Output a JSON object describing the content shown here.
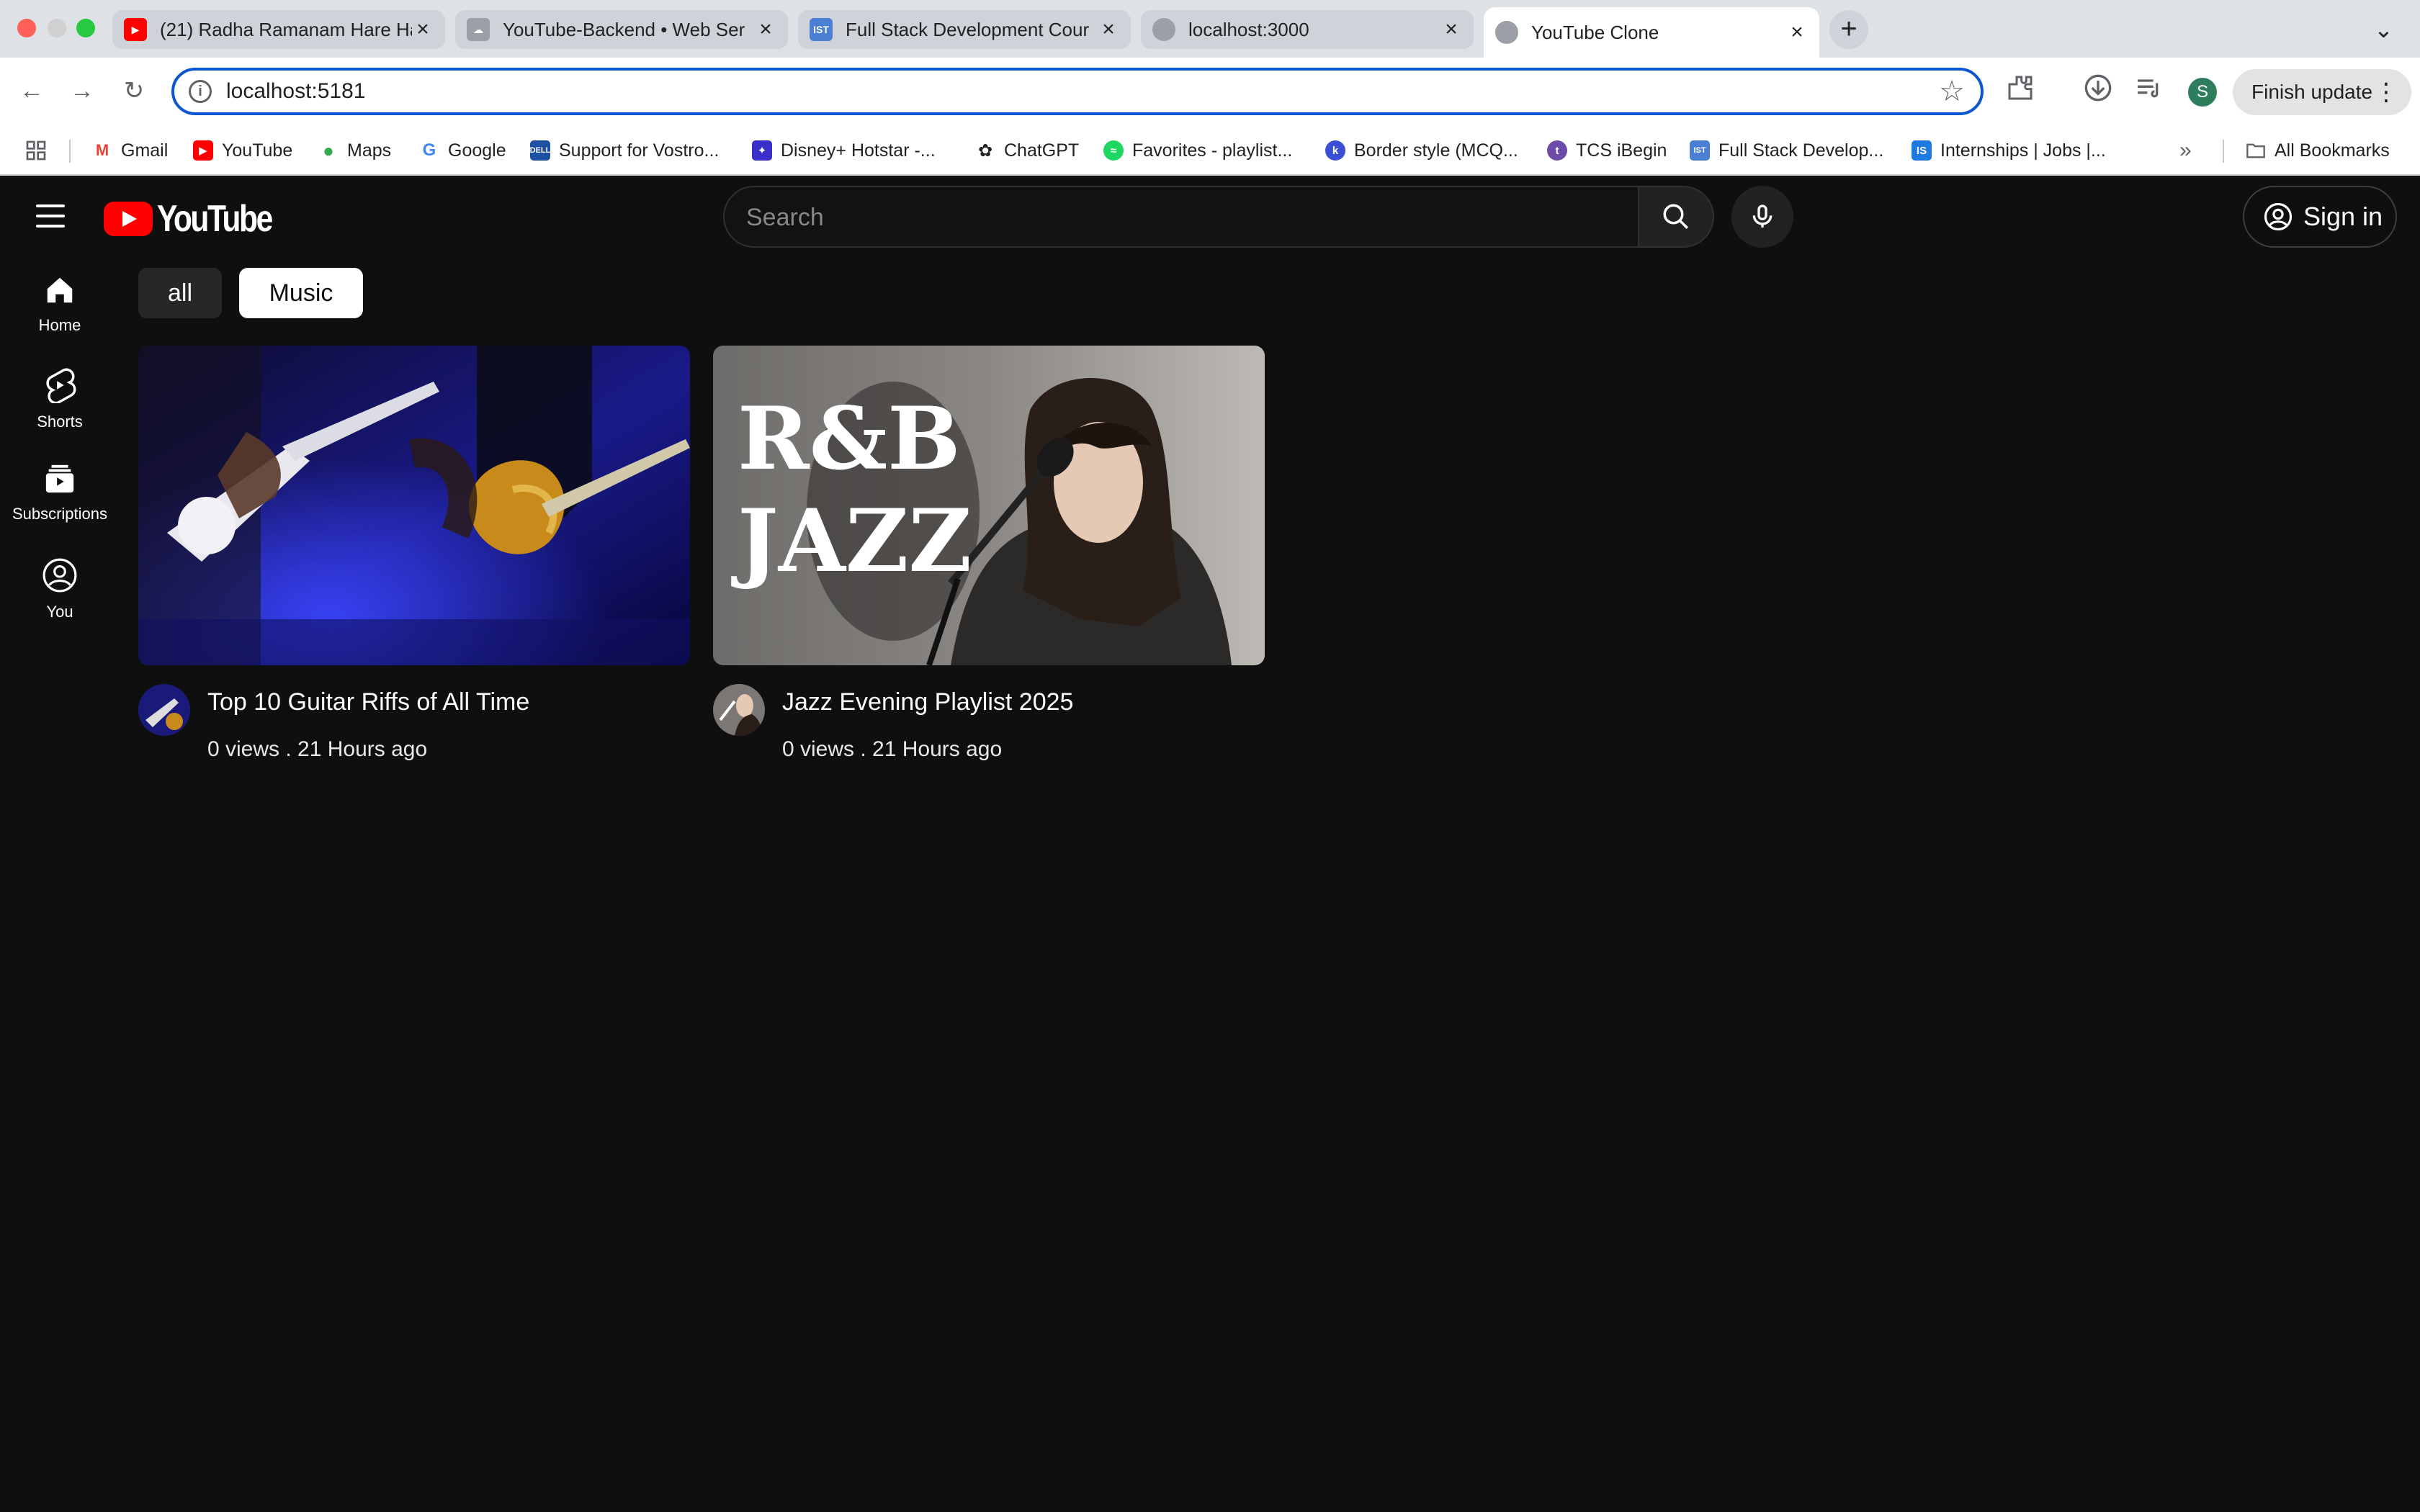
{
  "browser": {
    "tabs": [
      {
        "label": "(21) Radha Ramanam Hare Ha",
        "favicon": "youtube-icon",
        "active": false
      },
      {
        "label": "YouTube-Backend • Web Ser",
        "favicon": "cloud-icon",
        "active": false
      },
      {
        "label": "Full Stack Development Cour",
        "favicon": "ist-icon",
        "active": false
      },
      {
        "label": "localhost:3000",
        "favicon": "globe-icon",
        "active": false
      },
      {
        "label": "YouTube Clone",
        "favicon": "globe-icon",
        "active": true
      }
    ],
    "new_tab_symbol": "+",
    "address_bar": {
      "url": "localhost:5181"
    },
    "profile_initial": "S",
    "finish_update_label": "Finish update",
    "bookmarks": [
      {
        "label": "Gmail",
        "icon": "gmail-icon"
      },
      {
        "label": "YouTube",
        "icon": "youtube-icon"
      },
      {
        "label": "Maps",
        "icon": "maps-icon"
      },
      {
        "label": "Google",
        "icon": "google-icon"
      },
      {
        "label": "Support for Vostro...",
        "icon": "dell-icon"
      },
      {
        "label": "Disney+ Hotstar -...",
        "icon": "hotstar-icon"
      },
      {
        "label": "ChatGPT",
        "icon": "chatgpt-icon"
      },
      {
        "label": "Favorites - playlist...",
        "icon": "spotify-icon"
      },
      {
        "label": "Border style (MCQ...",
        "icon": "quiz-icon"
      },
      {
        "label": "TCS iBegin",
        "icon": "tcs-icon"
      },
      {
        "label": "Full Stack Develop...",
        "icon": "ist-icon"
      },
      {
        "label": "Internships | Jobs |...",
        "icon": "internshala-icon"
      }
    ],
    "all_bookmarks_label": "All Bookmarks"
  },
  "app": {
    "logo_text": "YouTube",
    "search": {
      "placeholder": "Search"
    },
    "sign_in_label": "Sign in",
    "sidebar": [
      {
        "label": "Home",
        "icon": "home-icon"
      },
      {
        "label": "Shorts",
        "icon": "shorts-icon"
      },
      {
        "label": "Subscriptions",
        "icon": "subscriptions-icon"
      },
      {
        "label": "You",
        "icon": "user-icon"
      }
    ],
    "filters": [
      {
        "label": "all",
        "selected": false
      },
      {
        "label": "Music",
        "selected": true
      }
    ],
    "videos": [
      {
        "title": "Top 10 Guitar Riffs of All Time",
        "stats": "0 views .   21 Hours ago"
      },
      {
        "title": "Jazz Evening Playlist 2025",
        "stats": "0 views .   21 Hours ago",
        "thumb_text_1": "R&B",
        "thumb_text_2": "JAZZ"
      }
    ]
  },
  "colors": {
    "page_bg": "#0f0f0f",
    "accent_red": "#ff0000",
    "omnibox_border": "#0b57d0"
  }
}
